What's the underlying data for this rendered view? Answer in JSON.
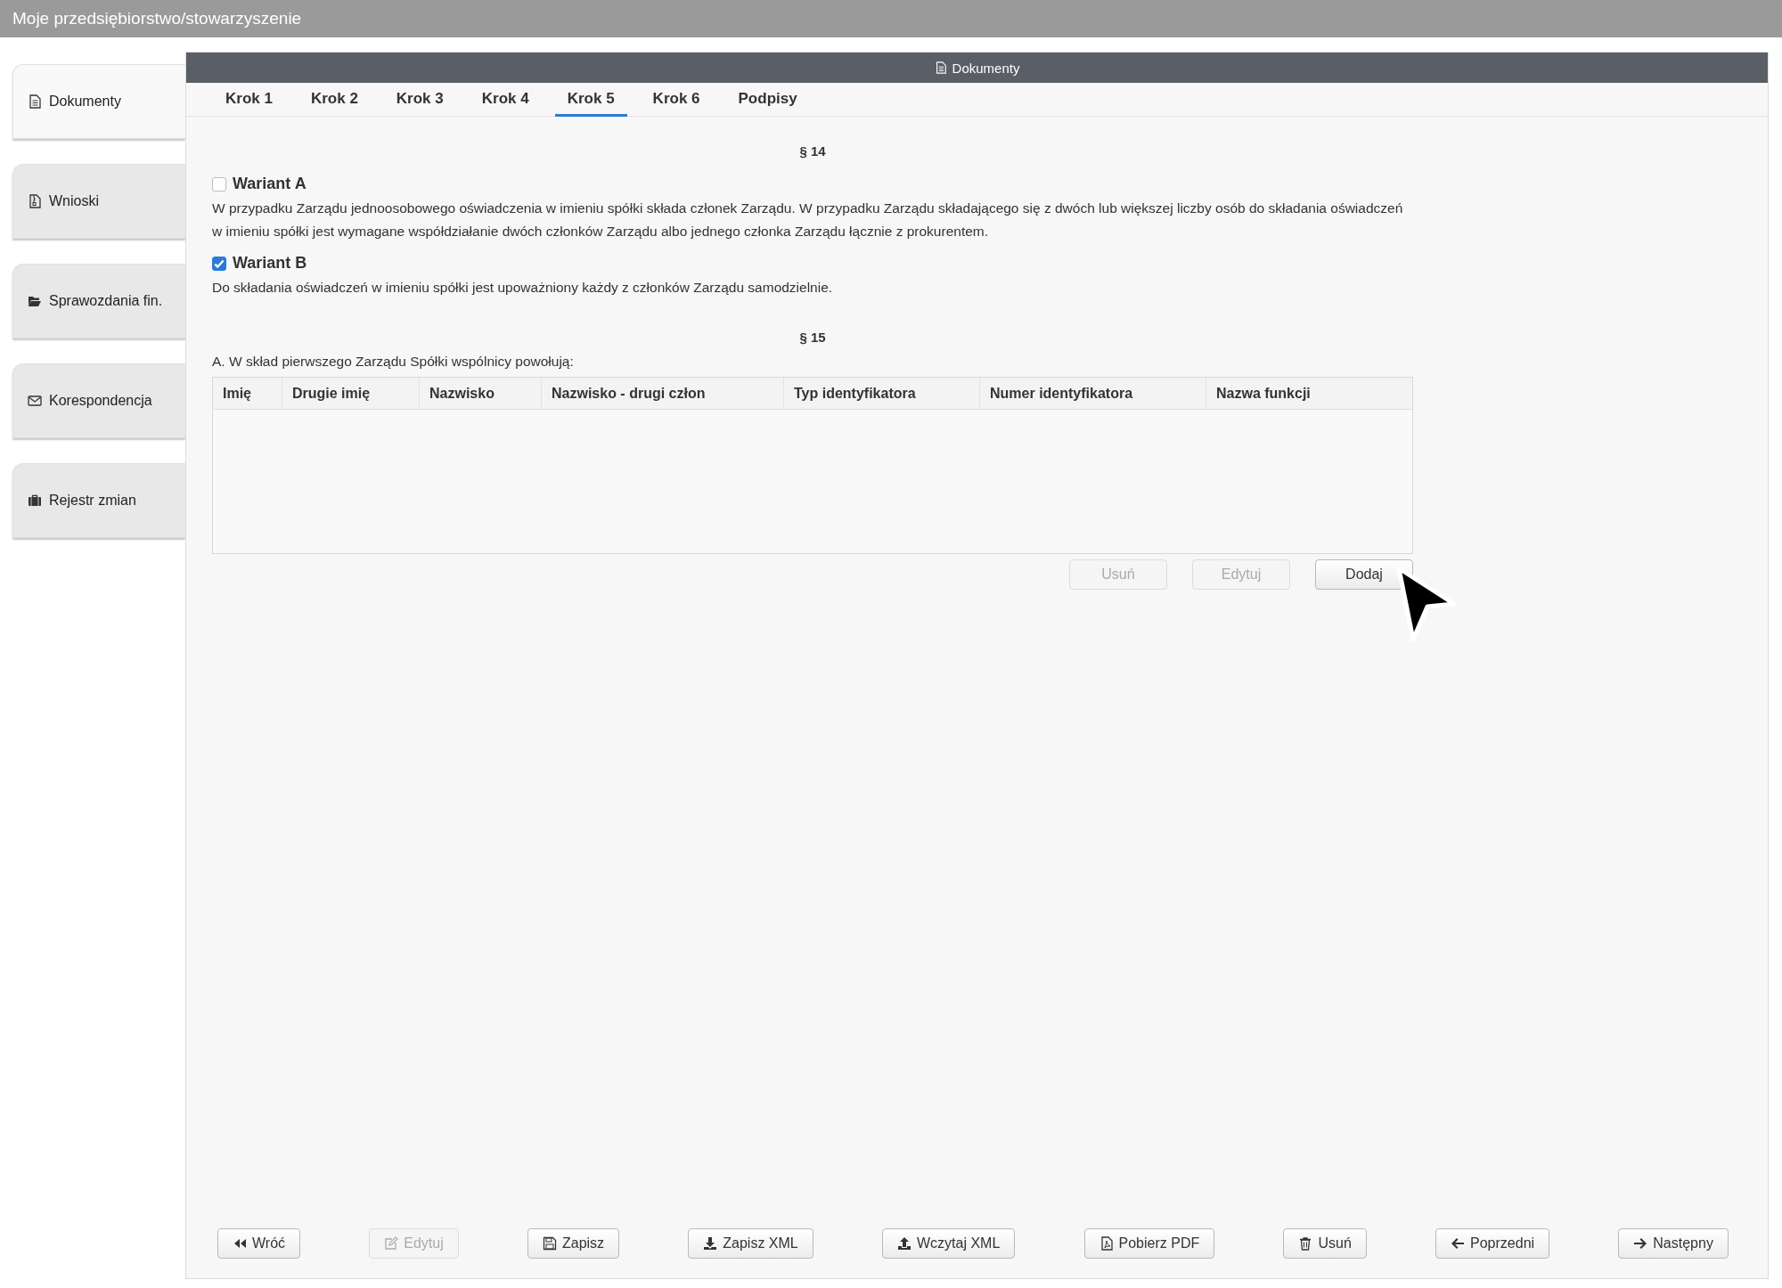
{
  "app_bar": {
    "title": "Moje przedsiębiorstwo/stowarzyszenie"
  },
  "sidebar": {
    "items": [
      {
        "label": "Dokumenty",
        "selected": true
      },
      {
        "label": "Wnioski",
        "selected": false
      },
      {
        "label": "Sprawozdania fin.",
        "selected": false
      },
      {
        "label": "Korespondencja",
        "selected": false
      },
      {
        "label": "Rejestr zmian",
        "selected": false
      }
    ]
  },
  "panel": {
    "title": "Dokumenty"
  },
  "tabs": [
    {
      "label": "Krok 1",
      "selected": false
    },
    {
      "label": "Krok 2",
      "selected": false
    },
    {
      "label": "Krok 3",
      "selected": false
    },
    {
      "label": "Krok 4",
      "selected": false
    },
    {
      "label": "Krok 5",
      "selected": true
    },
    {
      "label": "Krok 6",
      "selected": false
    },
    {
      "label": "Podpisy",
      "selected": false
    }
  ],
  "sections": [
    {
      "kind": "variants",
      "heading": "§ 14",
      "variants": [
        {
          "label": "Wariant A",
          "checked": false,
          "text": "W przypadku Zarządu jednoosobowego oświadczenia w imieniu spółki składa członek Zarządu. W przypadku Zarządu składającego się z dwóch lub większej liczby osób do składania oświadczeń w imieniu spółki jest wymagane współdziałanie dwóch członków Zarządu albo jednego członka Zarządu łącznie z prokurentem."
        },
        {
          "label": "Wariant B",
          "checked": true,
          "text": "Do składania oświadczeń w imieniu spółki jest upoważniony każdy z członków Zarządu samodzielnie."
        }
      ]
    },
    {
      "kind": "table",
      "heading": "§ 15",
      "caption": "A. W skład pierwszego Zarządu Spółki wspólnicy powołują:",
      "columns": [
        "Imię",
        "Drugie imię",
        "Nazwisko",
        "Nazwisko - drugi człon",
        "Typ identyfikatora",
        "Numer identyfikatora",
        "Nazwa funkcji"
      ],
      "actions": [
        {
          "label": "Usuń",
          "disabled": true
        },
        {
          "label": "Edytuj",
          "disabled": true
        },
        {
          "label": "Dodaj",
          "disabled": false
        }
      ]
    }
  ],
  "footer_buttons": [
    {
      "label": "Wróć",
      "disabled": false
    },
    {
      "label": "Edytuj",
      "disabled": true
    },
    {
      "label": "Zapisz",
      "disabled": false
    },
    {
      "label": "Zapisz XML",
      "disabled": false
    },
    {
      "label": "Wczytaj XML",
      "disabled": false
    },
    {
      "label": "Pobierz PDF",
      "disabled": false
    },
    {
      "label": "Usuń",
      "disabled": false
    },
    {
      "label": "Poprzedni",
      "disabled": false
    },
    {
      "label": "Następny",
      "disabled": false
    }
  ]
}
